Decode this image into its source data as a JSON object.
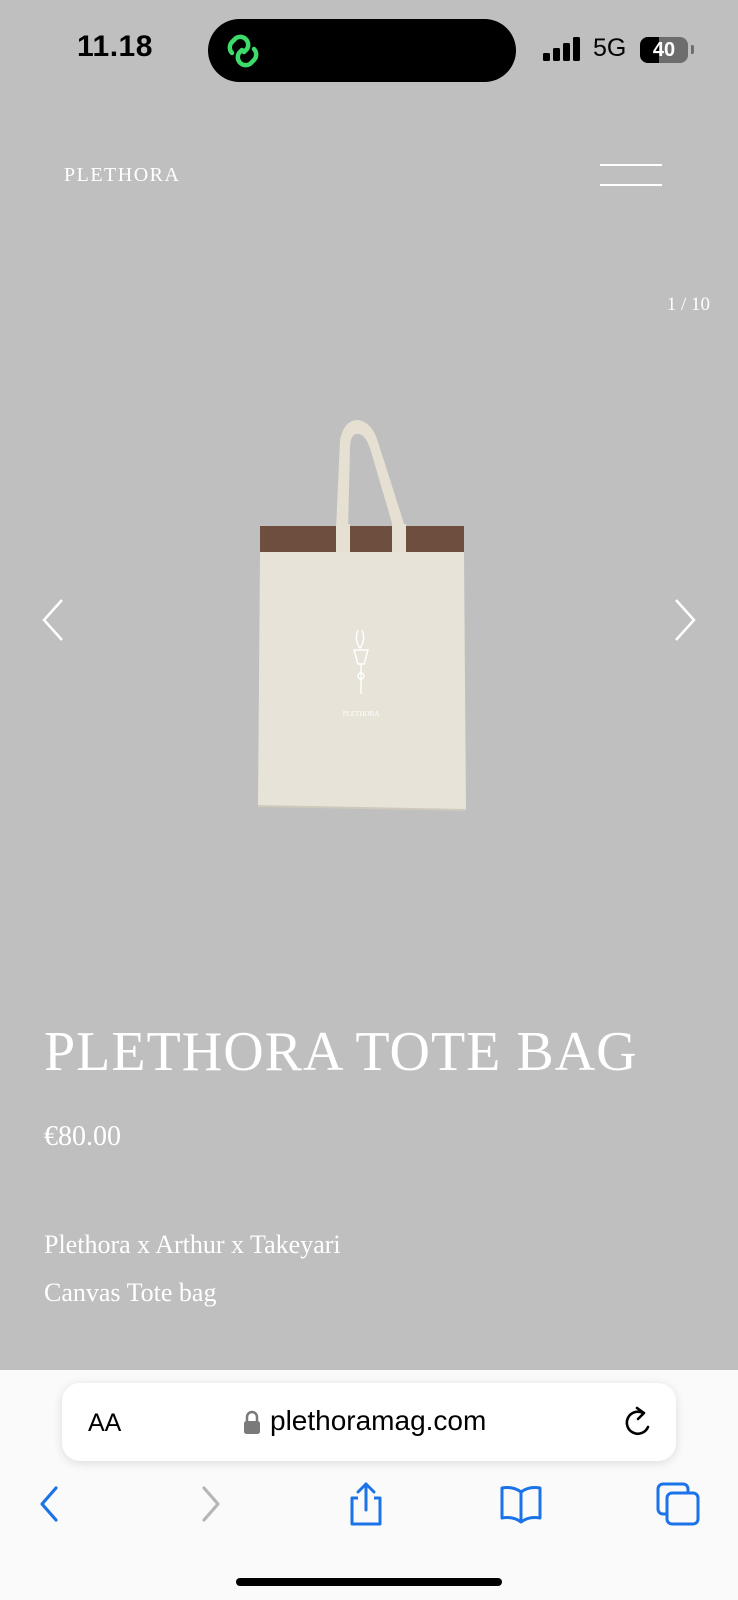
{
  "status_bar": {
    "time": "11.18",
    "network": "5G",
    "battery_level": "40",
    "battery_fraction": 0.4,
    "activity_icon": "linked-rings-icon",
    "activity_color": "#3ddc6a"
  },
  "header": {
    "brand": "PLETHORA",
    "menu_icon": "hamburger-menu-icon"
  },
  "gallery": {
    "counter": "1 / 10",
    "prev_icon": "chevron-left-icon",
    "next_icon": "chevron-right-icon",
    "image_logo_text": "PLETHORA"
  },
  "product": {
    "title": "PLETHORA TOTE BAG",
    "price": "€80.00",
    "description_line1": "Plethora x Arthur x Takeyari",
    "description_line2": "Canvas Tote bag"
  },
  "browser": {
    "text_size_label": "AA",
    "url": "plethoramag.com",
    "accent_color": "#1a73e8",
    "toolbar": [
      "back-icon",
      "forward-icon",
      "share-icon",
      "bookmarks-icon",
      "tabs-icon"
    ]
  }
}
